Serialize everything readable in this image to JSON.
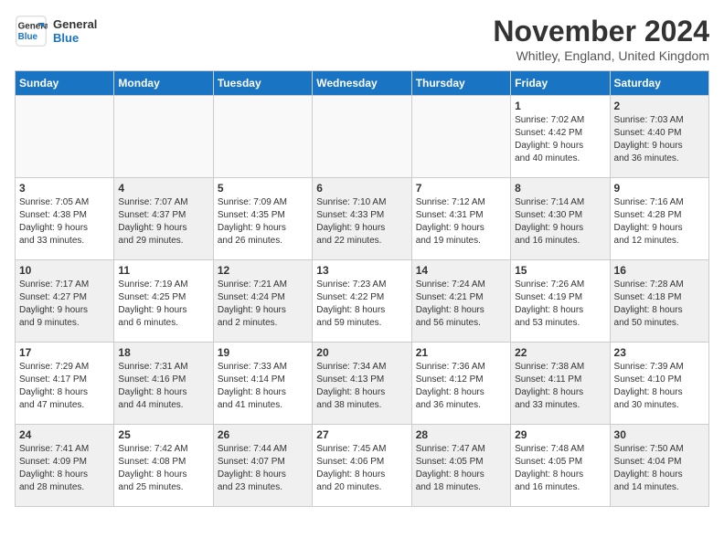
{
  "header": {
    "logo_line1": "General",
    "logo_line2": "Blue",
    "month": "November 2024",
    "location": "Whitley, England, United Kingdom"
  },
  "weekdays": [
    "Sunday",
    "Monday",
    "Tuesday",
    "Wednesday",
    "Thursday",
    "Friday",
    "Saturday"
  ],
  "weeks": [
    [
      {
        "day": "",
        "info": "",
        "empty": true
      },
      {
        "day": "",
        "info": "",
        "empty": true
      },
      {
        "day": "",
        "info": "",
        "empty": true
      },
      {
        "day": "",
        "info": "",
        "empty": true
      },
      {
        "day": "",
        "info": "",
        "empty": true
      },
      {
        "day": "1",
        "info": "Sunrise: 7:02 AM\nSunset: 4:42 PM\nDaylight: 9 hours\nand 40 minutes.",
        "empty": false
      },
      {
        "day": "2",
        "info": "Sunrise: 7:03 AM\nSunset: 4:40 PM\nDaylight: 9 hours\nand 36 minutes.",
        "empty": false
      }
    ],
    [
      {
        "day": "3",
        "info": "Sunrise: 7:05 AM\nSunset: 4:38 PM\nDaylight: 9 hours\nand 33 minutes.",
        "empty": false
      },
      {
        "day": "4",
        "info": "Sunrise: 7:07 AM\nSunset: 4:37 PM\nDaylight: 9 hours\nand 29 minutes.",
        "empty": false
      },
      {
        "day": "5",
        "info": "Sunrise: 7:09 AM\nSunset: 4:35 PM\nDaylight: 9 hours\nand 26 minutes.",
        "empty": false
      },
      {
        "day": "6",
        "info": "Sunrise: 7:10 AM\nSunset: 4:33 PM\nDaylight: 9 hours\nand 22 minutes.",
        "empty": false
      },
      {
        "day": "7",
        "info": "Sunrise: 7:12 AM\nSunset: 4:31 PM\nDaylight: 9 hours\nand 19 minutes.",
        "empty": false
      },
      {
        "day": "8",
        "info": "Sunrise: 7:14 AM\nSunset: 4:30 PM\nDaylight: 9 hours\nand 16 minutes.",
        "empty": false
      },
      {
        "day": "9",
        "info": "Sunrise: 7:16 AM\nSunset: 4:28 PM\nDaylight: 9 hours\nand 12 minutes.",
        "empty": false
      }
    ],
    [
      {
        "day": "10",
        "info": "Sunrise: 7:17 AM\nSunset: 4:27 PM\nDaylight: 9 hours\nand 9 minutes.",
        "empty": false
      },
      {
        "day": "11",
        "info": "Sunrise: 7:19 AM\nSunset: 4:25 PM\nDaylight: 9 hours\nand 6 minutes.",
        "empty": false
      },
      {
        "day": "12",
        "info": "Sunrise: 7:21 AM\nSunset: 4:24 PM\nDaylight: 9 hours\nand 2 minutes.",
        "empty": false
      },
      {
        "day": "13",
        "info": "Sunrise: 7:23 AM\nSunset: 4:22 PM\nDaylight: 8 hours\nand 59 minutes.",
        "empty": false
      },
      {
        "day": "14",
        "info": "Sunrise: 7:24 AM\nSunset: 4:21 PM\nDaylight: 8 hours\nand 56 minutes.",
        "empty": false
      },
      {
        "day": "15",
        "info": "Sunrise: 7:26 AM\nSunset: 4:19 PM\nDaylight: 8 hours\nand 53 minutes.",
        "empty": false
      },
      {
        "day": "16",
        "info": "Sunrise: 7:28 AM\nSunset: 4:18 PM\nDaylight: 8 hours\nand 50 minutes.",
        "empty": false
      }
    ],
    [
      {
        "day": "17",
        "info": "Sunrise: 7:29 AM\nSunset: 4:17 PM\nDaylight: 8 hours\nand 47 minutes.",
        "empty": false
      },
      {
        "day": "18",
        "info": "Sunrise: 7:31 AM\nSunset: 4:16 PM\nDaylight: 8 hours\nand 44 minutes.",
        "empty": false
      },
      {
        "day": "19",
        "info": "Sunrise: 7:33 AM\nSunset: 4:14 PM\nDaylight: 8 hours\nand 41 minutes.",
        "empty": false
      },
      {
        "day": "20",
        "info": "Sunrise: 7:34 AM\nSunset: 4:13 PM\nDaylight: 8 hours\nand 38 minutes.",
        "empty": false
      },
      {
        "day": "21",
        "info": "Sunrise: 7:36 AM\nSunset: 4:12 PM\nDaylight: 8 hours\nand 36 minutes.",
        "empty": false
      },
      {
        "day": "22",
        "info": "Sunrise: 7:38 AM\nSunset: 4:11 PM\nDaylight: 8 hours\nand 33 minutes.",
        "empty": false
      },
      {
        "day": "23",
        "info": "Sunrise: 7:39 AM\nSunset: 4:10 PM\nDaylight: 8 hours\nand 30 minutes.",
        "empty": false
      }
    ],
    [
      {
        "day": "24",
        "info": "Sunrise: 7:41 AM\nSunset: 4:09 PM\nDaylight: 8 hours\nand 28 minutes.",
        "empty": false
      },
      {
        "day": "25",
        "info": "Sunrise: 7:42 AM\nSunset: 4:08 PM\nDaylight: 8 hours\nand 25 minutes.",
        "empty": false
      },
      {
        "day": "26",
        "info": "Sunrise: 7:44 AM\nSunset: 4:07 PM\nDaylight: 8 hours\nand 23 minutes.",
        "empty": false
      },
      {
        "day": "27",
        "info": "Sunrise: 7:45 AM\nSunset: 4:06 PM\nDaylight: 8 hours\nand 20 minutes.",
        "empty": false
      },
      {
        "day": "28",
        "info": "Sunrise: 7:47 AM\nSunset: 4:05 PM\nDaylight: 8 hours\nand 18 minutes.",
        "empty": false
      },
      {
        "day": "29",
        "info": "Sunrise: 7:48 AM\nSunset: 4:05 PM\nDaylight: 8 hours\nand 16 minutes.",
        "empty": false
      },
      {
        "day": "30",
        "info": "Sunrise: 7:50 AM\nSunset: 4:04 PM\nDaylight: 8 hours\nand 14 minutes.",
        "empty": false
      }
    ]
  ]
}
